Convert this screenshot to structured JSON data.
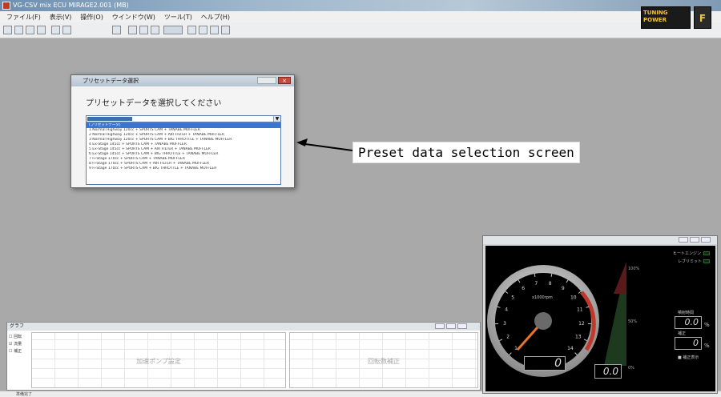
{
  "window": {
    "title": "VG-CSV mix ECU MIRAGE2.001 (MB)"
  },
  "menu": [
    "ファイル(F)",
    "表示(V)",
    "操作(O)",
    "ウインドウ(W)",
    "ツール(T)",
    "ヘルプ(H)"
  ],
  "brand": {
    "badge_text": "TUNING POWER",
    "logo_text": "F"
  },
  "dialog": {
    "title": "プリセットデータ選択",
    "prompt": "プリセットデータを選択してください",
    "selected": "プリセットデータ",
    "items": [
      "(プリセットデータ)",
      "1 Normal Highway 120cc + SPORTS CAM + TANABE MUFFLER",
      "2 Normal Highway 120cc + SPORTS CAM + AIR FILTER + TANABE MUFFLER",
      "3 Normal Highway 120cc + SPORTS CAM + BIG THROTTLE + TANABE MUFFLER",
      "4 Ex-Stage 145cc + SPORTS CAM + TANABE MUFFLER",
      "5 Ex-Stage 145cc + SPORTS CAM + AIR FILTER + TANABE MUFFLER",
      "6 Ex-Stage 145cc + SPORTS CAM + BIG THROTTLE + TANABE MUFFLER",
      "7 Fi-Stage 170cc + SPORTS CAM + TANABE MUFFLER",
      "8 Fi-Stage 170cc + SPORTS CAM + AIR FILTER + TANABE MUFFLER",
      "9 Fi-Stage 170cc + SPORTS CAM + BIG THROTTLE + TANABE MUFFLER"
    ]
  },
  "annotation": {
    "label": "Preset data selection screen"
  },
  "graph_panel": {
    "title": "グラフ",
    "checks": [
      "回転",
      "流量",
      "補正"
    ],
    "plot_left_label": "加速ポンプ設定",
    "plot_right_label": "回転数補正"
  },
  "tach": {
    "unit_label": "x1000rpm",
    "ticks": [
      "1",
      "2",
      "3",
      "4",
      "5",
      "6",
      "7",
      "8",
      "9",
      "10",
      "11",
      "12",
      "13",
      "14"
    ],
    "rpm_value": "0",
    "throttle_value": "0.0",
    "pct_100": "100%",
    "pct_50": "50%",
    "pct_0": "0%",
    "aux_labels": [
      "ヒートエンジン",
      "レブリミット"
    ],
    "field1_label": "噴射時間",
    "field1_value": "0.0",
    "field1_unit": "%",
    "field2_label": "補正",
    "field2_value": "0",
    "field2_unit": "%",
    "checkbox_label": "補正表示"
  },
  "status": {
    "text": "準備完了"
  }
}
